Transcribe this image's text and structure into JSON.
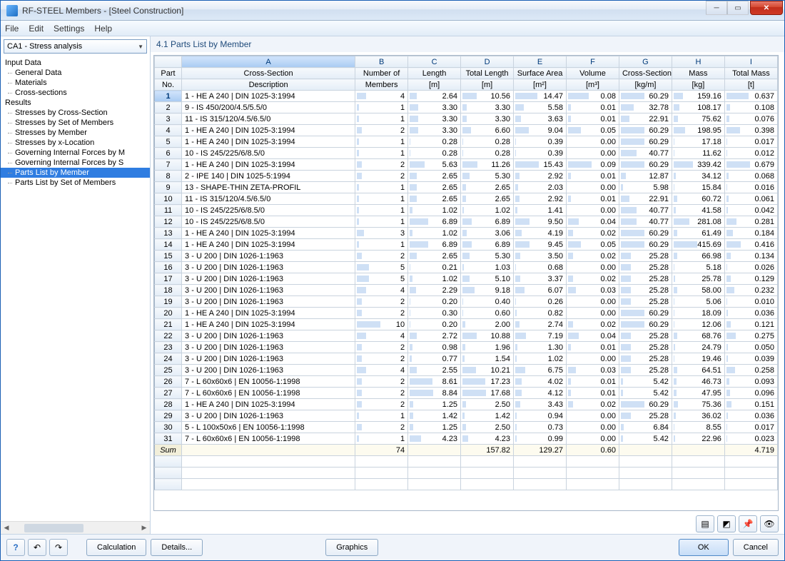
{
  "window": {
    "title": "RF-STEEL Members - [Steel Construction]"
  },
  "menu": {
    "file": "File",
    "edit": "Edit",
    "settings": "Settings",
    "help": "Help"
  },
  "dropdown": {
    "value": "CA1 - Stress analysis"
  },
  "tree": {
    "input_label": "Input Data",
    "input": [
      "General Data",
      "Materials",
      "Cross-sections"
    ],
    "results_label": "Results",
    "results": [
      "Stresses by Cross-Section",
      "Stresses by Set of Members",
      "Stresses by Member",
      "Stresses by x-Location",
      "Governing Internal Forces by M",
      "Governing Internal Forces by S",
      "Parts List by Member",
      "Parts List by Set of Members"
    ],
    "selected": "Parts List by Member"
  },
  "panel": {
    "title": "4.1 Parts List by Member"
  },
  "columns": {
    "letters": [
      "A",
      "B",
      "C",
      "D",
      "E",
      "F",
      "G",
      "H",
      "I"
    ],
    "part_no": [
      "Part",
      "No."
    ],
    "headers1": [
      "Cross-Section",
      "Number of",
      "Length",
      "Total Length",
      "Surface Area",
      "Volume",
      "Cross-Section",
      "Mass",
      "Total Mass"
    ],
    "headers2": [
      "Description",
      "Members",
      "[m]",
      "[m]",
      "[m²]",
      "[m³]",
      "[kg/m]",
      "[kg]",
      "[t]"
    ]
  },
  "chart_data": {
    "type": "table",
    "title": "4.1 Parts List by Member",
    "columns": [
      "Part No.",
      "Cross-Section Description",
      "Number of Members",
      "Length [m]",
      "Total Length [m]",
      "Surface Area [m2]",
      "Volume [m3]",
      "Cross-Section [kg/m]",
      "Mass [kg]",
      "Total Mass [t]"
    ]
  },
  "rows": [
    {
      "n": 1,
      "desc": "1 - HE A 240 | DIN 1025-3:1994",
      "members": 4,
      "len": 2.64,
      "tot": 10.56,
      "surf": 14.47,
      "vol": 0.08,
      "cs": 60.29,
      "mass": 159.16,
      "tmass": 0.637
    },
    {
      "n": 2,
      "desc": "9 - IS 450/200/4.5/5.5/0",
      "members": 1,
      "len": 3.3,
      "tot": 3.3,
      "surf": 5.58,
      "vol": 0.01,
      "cs": 32.78,
      "mass": 108.17,
      "tmass": 0.108
    },
    {
      "n": 3,
      "desc": "11 - IS 315/120/4.5/6.5/0",
      "members": 1,
      "len": 3.3,
      "tot": 3.3,
      "surf": 3.63,
      "vol": 0.01,
      "cs": 22.91,
      "mass": 75.62,
      "tmass": 0.076
    },
    {
      "n": 4,
      "desc": "1 - HE A 240 | DIN 1025-3:1994",
      "members": 2,
      "len": 3.3,
      "tot": 6.6,
      "surf": 9.04,
      "vol": 0.05,
      "cs": 60.29,
      "mass": 198.95,
      "tmass": 0.398
    },
    {
      "n": 5,
      "desc": "1 - HE A 240 | DIN 1025-3:1994",
      "members": 1,
      "len": 0.28,
      "tot": 0.28,
      "surf": 0.39,
      "vol": 0.0,
      "cs": 60.29,
      "mass": 17.18,
      "tmass": 0.017
    },
    {
      "n": 6,
      "desc": "10 - IS 245/225/6/8.5/0",
      "members": 1,
      "len": 0.28,
      "tot": 0.28,
      "surf": 0.39,
      "vol": 0.0,
      "cs": 40.77,
      "mass": 11.62,
      "tmass": 0.012
    },
    {
      "n": 7,
      "desc": "1 - HE A 240 | DIN 1025-3:1994",
      "members": 2,
      "len": 5.63,
      "tot": 11.26,
      "surf": 15.43,
      "vol": 0.09,
      "cs": 60.29,
      "mass": 339.42,
      "tmass": 0.679
    },
    {
      "n": 8,
      "desc": "2 - IPE 140 | DIN 1025-5:1994",
      "members": 2,
      "len": 2.65,
      "tot": 5.3,
      "surf": 2.92,
      "vol": 0.01,
      "cs": 12.87,
      "mass": 34.12,
      "tmass": 0.068
    },
    {
      "n": 9,
      "desc": "13 - SHAPE-THIN ZETA-PROFIL",
      "members": 1,
      "len": 2.65,
      "tot": 2.65,
      "surf": 2.03,
      "vol": 0.0,
      "cs": 5.98,
      "mass": 15.84,
      "tmass": 0.016
    },
    {
      "n": 10,
      "desc": "11 - IS 315/120/4.5/6.5/0",
      "members": 1,
      "len": 2.65,
      "tot": 2.65,
      "surf": 2.92,
      "vol": 0.01,
      "cs": 22.91,
      "mass": 60.72,
      "tmass": 0.061
    },
    {
      "n": 11,
      "desc": "10 - IS 245/225/6/8.5/0",
      "members": 1,
      "len": 1.02,
      "tot": 1.02,
      "surf": 1.41,
      "vol": 0.0,
      "cs": 40.77,
      "mass": 41.58,
      "tmass": 0.042
    },
    {
      "n": 12,
      "desc": "10 - IS 245/225/6/8.5/0",
      "members": 1,
      "len": 6.89,
      "tot": 6.89,
      "surf": 9.5,
      "vol": 0.04,
      "cs": 40.77,
      "mass": 281.08,
      "tmass": 0.281
    },
    {
      "n": 13,
      "desc": "1 - HE A 240 | DIN 1025-3:1994",
      "members": 3,
      "len": 1.02,
      "tot": 3.06,
      "surf": 4.19,
      "vol": 0.02,
      "cs": 60.29,
      "mass": 61.49,
      "tmass": 0.184
    },
    {
      "n": 14,
      "desc": "1 - HE A 240 | DIN 1025-3:1994",
      "members": 1,
      "len": 6.89,
      "tot": 6.89,
      "surf": 9.45,
      "vol": 0.05,
      "cs": 60.29,
      "mass": 415.69,
      "tmass": 0.416
    },
    {
      "n": 15,
      "desc": "3 - U 200 | DIN 1026-1:1963",
      "members": 2,
      "len": 2.65,
      "tot": 5.3,
      "surf": 3.5,
      "vol": 0.02,
      "cs": 25.28,
      "mass": 66.98,
      "tmass": 0.134
    },
    {
      "n": 16,
      "desc": "3 - U 200 | DIN 1026-1:1963",
      "members": 5,
      "len": 0.21,
      "tot": 1.03,
      "surf": 0.68,
      "vol": 0.0,
      "cs": 25.28,
      "mass": 5.18,
      "tmass": 0.026
    },
    {
      "n": 17,
      "desc": "3 - U 200 | DIN 1026-1:1963",
      "members": 5,
      "len": 1.02,
      "tot": 5.1,
      "surf": 3.37,
      "vol": 0.02,
      "cs": 25.28,
      "mass": 25.78,
      "tmass": 0.129
    },
    {
      "n": 18,
      "desc": "3 - U 200 | DIN 1026-1:1963",
      "members": 4,
      "len": 2.29,
      "tot": 9.18,
      "surf": 6.07,
      "vol": 0.03,
      "cs": 25.28,
      "mass": 58.0,
      "tmass": 0.232
    },
    {
      "n": 19,
      "desc": "3 - U 200 | DIN 1026-1:1963",
      "members": 2,
      "len": 0.2,
      "tot": 0.4,
      "surf": 0.26,
      "vol": 0.0,
      "cs": 25.28,
      "mass": 5.06,
      "tmass": 0.01
    },
    {
      "n": 20,
      "desc": "1 - HE A 240 | DIN 1025-3:1994",
      "members": 2,
      "len": 0.3,
      "tot": 0.6,
      "surf": 0.82,
      "vol": 0.0,
      "cs": 60.29,
      "mass": 18.09,
      "tmass": 0.036
    },
    {
      "n": 21,
      "desc": "1 - HE A 240 | DIN 1025-3:1994",
      "members": 10,
      "len": 0.2,
      "tot": 2.0,
      "surf": 2.74,
      "vol": 0.02,
      "cs": 60.29,
      "mass": 12.06,
      "tmass": 0.121
    },
    {
      "n": 22,
      "desc": "3 - U 200 | DIN 1026-1:1963",
      "members": 4,
      "len": 2.72,
      "tot": 10.88,
      "surf": 7.19,
      "vol": 0.04,
      "cs": 25.28,
      "mass": 68.76,
      "tmass": 0.275
    },
    {
      "n": 23,
      "desc": "3 - U 200 | DIN 1026-1:1963",
      "members": 2,
      "len": 0.98,
      "tot": 1.96,
      "surf": 1.3,
      "vol": 0.01,
      "cs": 25.28,
      "mass": 24.79,
      "tmass": 0.05
    },
    {
      "n": 24,
      "desc": "3 - U 200 | DIN 1026-1:1963",
      "members": 2,
      "len": 0.77,
      "tot": 1.54,
      "surf": 1.02,
      "vol": 0.0,
      "cs": 25.28,
      "mass": 19.46,
      "tmass": 0.039
    },
    {
      "n": 25,
      "desc": "3 - U 200 | DIN 1026-1:1963",
      "members": 4,
      "len": 2.55,
      "tot": 10.21,
      "surf": 6.75,
      "vol": 0.03,
      "cs": 25.28,
      "mass": 64.51,
      "tmass": 0.258
    },
    {
      "n": 26,
      "desc": "7 - L 60x60x6 | EN 10056-1:1998",
      "members": 2,
      "len": 8.61,
      "tot": 17.23,
      "surf": 4.02,
      "vol": 0.01,
      "cs": 5.42,
      "mass": 46.73,
      "tmass": 0.093
    },
    {
      "n": 27,
      "desc": "7 - L 60x60x6 | EN 10056-1:1998",
      "members": 2,
      "len": 8.84,
      "tot": 17.68,
      "surf": 4.12,
      "vol": 0.01,
      "cs": 5.42,
      "mass": 47.95,
      "tmass": 0.096
    },
    {
      "n": 28,
      "desc": "1 - HE A 240 | DIN 1025-3:1994",
      "members": 2,
      "len": 1.25,
      "tot": 2.5,
      "surf": 3.43,
      "vol": 0.02,
      "cs": 60.29,
      "mass": 75.36,
      "tmass": 0.151
    },
    {
      "n": 29,
      "desc": "3 - U 200 | DIN 1026-1:1963",
      "members": 1,
      "len": 1.42,
      "tot": 1.42,
      "surf": 0.94,
      "vol": 0.0,
      "cs": 25.28,
      "mass": 36.02,
      "tmass": 0.036
    },
    {
      "n": 30,
      "desc": "5 - L 100x50x6 | EN 10056-1:1998",
      "members": 2,
      "len": 1.25,
      "tot": 2.5,
      "surf": 0.73,
      "vol": 0.0,
      "cs": 6.84,
      "mass": 8.55,
      "tmass": 0.017
    },
    {
      "n": 31,
      "desc": "7 - L 60x60x6 | EN 10056-1:1998",
      "members": 1,
      "len": 4.23,
      "tot": 4.23,
      "surf": 0.99,
      "vol": 0.0,
      "cs": 5.42,
      "mass": 22.96,
      "tmass": 0.023
    }
  ],
  "sum": {
    "label": "Sum",
    "members": 74,
    "tot": 157.82,
    "surf": 129.27,
    "vol": 0.6,
    "tmass": 4.719
  },
  "maxima": {
    "members": 10,
    "len": 8.84,
    "tot": 17.68,
    "surf": 15.43,
    "vol": 0.09,
    "cs": 60.29,
    "mass": 415.69,
    "tmass": 0.679
  },
  "buttons": {
    "calculation": "Calculation",
    "details": "Details...",
    "graphics": "Graphics",
    "ok": "OK",
    "cancel": "Cancel"
  }
}
